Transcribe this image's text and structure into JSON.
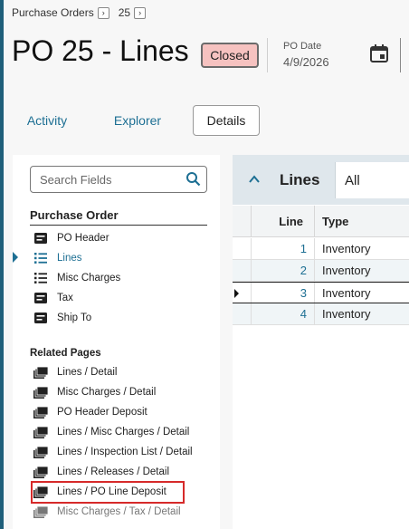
{
  "breadcrumb": {
    "items": [
      "Purchase Orders",
      "25"
    ],
    "separator_icon": "chevron-right-icon"
  },
  "header": {
    "title": "PO 25 - Lines",
    "status": "Closed",
    "po_date_label": "PO Date",
    "po_date_value": "4/9/2026",
    "calendar_icon": "calendar-icon"
  },
  "tabs": [
    {
      "label": "Activity",
      "active": false
    },
    {
      "label": "Explorer",
      "active": false
    },
    {
      "label": "Details",
      "active": true
    }
  ],
  "sidebar": {
    "search_placeholder": "Search Fields",
    "section_title": "Purchase Order",
    "items": [
      {
        "label": "PO Header",
        "icon": "form-icon"
      },
      {
        "label": "Lines",
        "icon": "list-icon",
        "active": true
      },
      {
        "label": "Misc Charges",
        "icon": "list-icon"
      },
      {
        "label": "Tax",
        "icon": "form-icon"
      },
      {
        "label": "Ship To",
        "icon": "form-icon"
      }
    ],
    "related_title": "Related Pages",
    "related": [
      {
        "label": "Lines / Detail",
        "icon": "pages-icon"
      },
      {
        "label": "Misc Charges / Detail",
        "icon": "pages-icon"
      },
      {
        "label": "PO Header Deposit",
        "icon": "pages-icon"
      },
      {
        "label": "Lines / Misc Charges / Detail",
        "icon": "pages-icon"
      },
      {
        "label": "Lines / Inspection List / Detail",
        "icon": "pages-icon"
      },
      {
        "label": "Lines / Releases / Detail",
        "icon": "pages-icon"
      },
      {
        "label": "Lines / PO Line Deposit",
        "icon": "pages-icon",
        "highlighted": true
      },
      {
        "label": "Misc Charges / Tax / Detail",
        "icon": "pages-icon"
      }
    ]
  },
  "grid": {
    "title": "Lines",
    "filter": "All",
    "columns": [
      "Line",
      "Type"
    ],
    "rows": [
      {
        "line": "1",
        "type": "Inventory"
      },
      {
        "line": "2",
        "type": "Inventory"
      },
      {
        "line": "3",
        "type": "Inventory",
        "selected": true
      },
      {
        "line": "4",
        "type": "Inventory"
      }
    ]
  },
  "colors": {
    "accent": "#1d6f93",
    "status_bg": "#f6c2c0",
    "highlight": "#d62a2a",
    "grid_header": "#dfe7ec"
  }
}
